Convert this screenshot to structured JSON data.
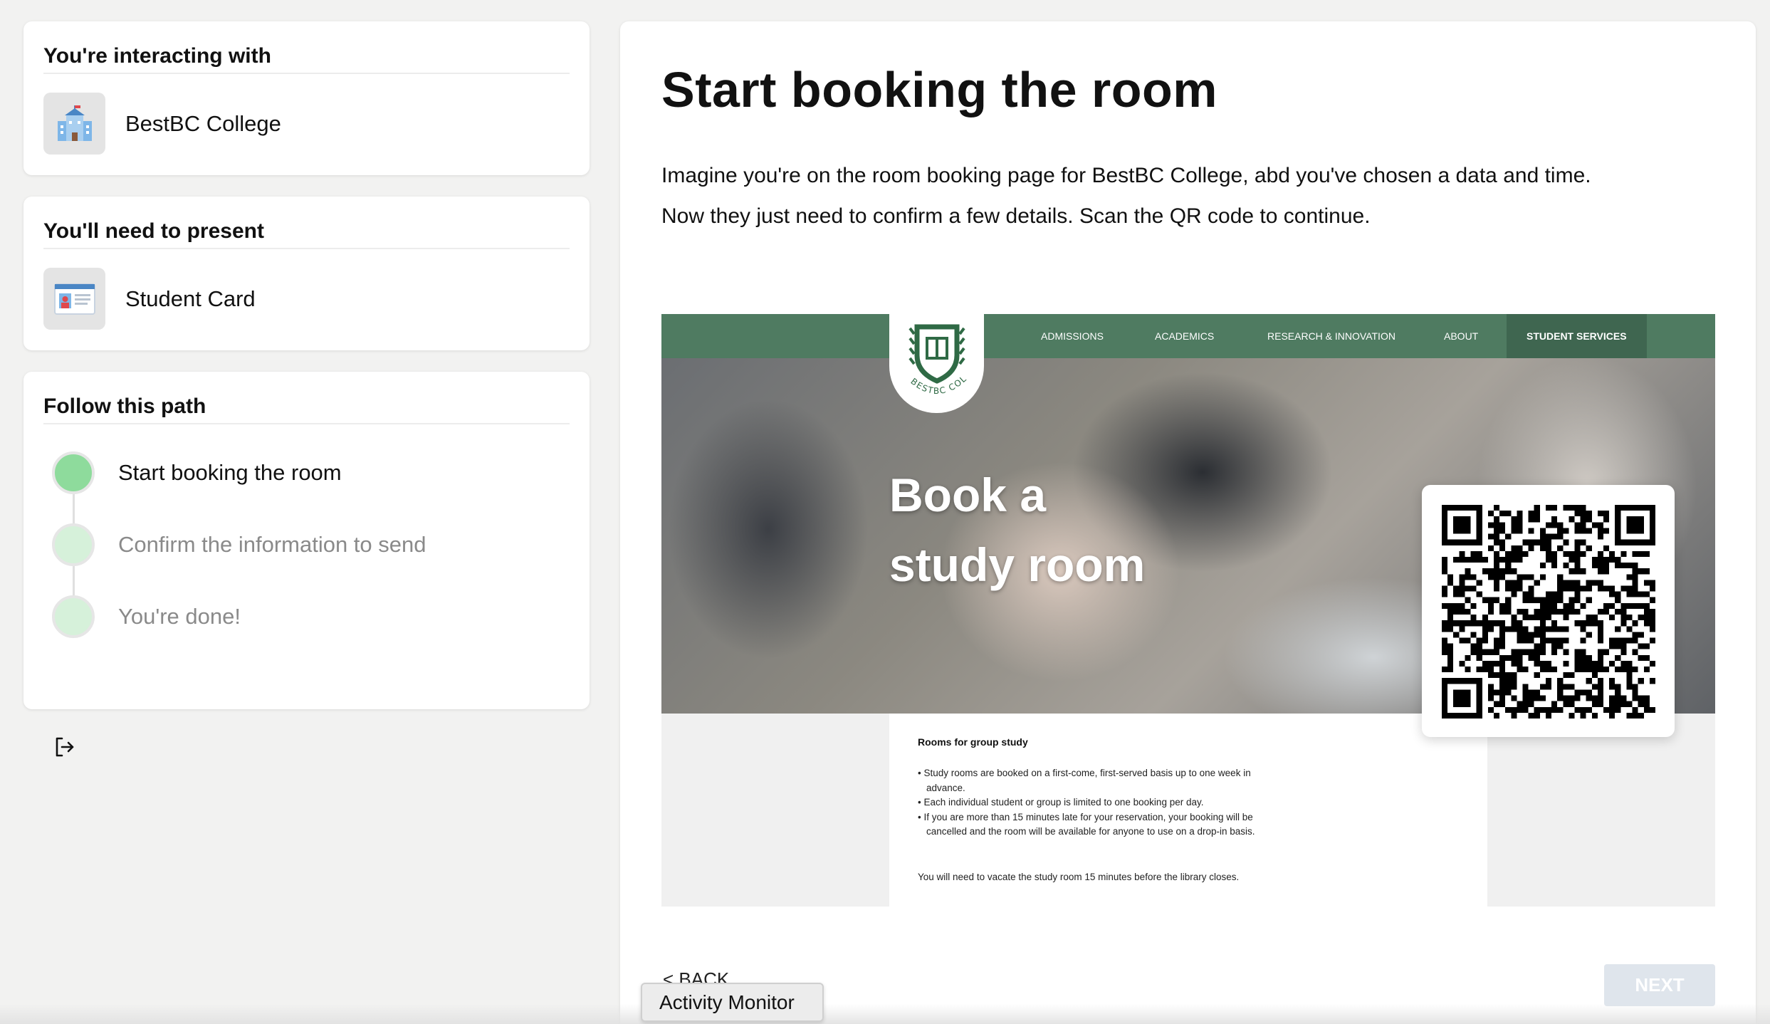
{
  "interacting": {
    "title": "You're interacting with",
    "name": "BestBC College",
    "icon": "school-building-icon"
  },
  "present": {
    "title": "You'll need to present",
    "name": "Student Card",
    "icon": "id-card-icon"
  },
  "path": {
    "title": "Follow this path",
    "steps": [
      {
        "label": "Start booking the room",
        "state": "active"
      },
      {
        "label": "Confirm the information to send",
        "state": "todo"
      },
      {
        "label": "You're done!",
        "state": "todo"
      }
    ]
  },
  "main": {
    "title": "Start booking the room",
    "description_line1": "Imagine you're on the room booking page for BestBC College, abd you've chosen a data and time.",
    "description_line2": "Now they just need to confirm a few details. Scan the QR code to continue."
  },
  "preview": {
    "nav": [
      "ADMISSIONS",
      "ACADEMICS",
      "RESEARCH & INNOVATION",
      "ABOUT",
      "STUDENT SERVICES"
    ],
    "nav_active": "STUDENT SERVICES",
    "logo_text": "BESTBC COLLEGE",
    "hero_line1": "Book a",
    "hero_line2": "study room",
    "content_heading": "Rooms for group study",
    "rules": [
      "Study rooms are booked on a first-come, first-served basis up to one week in advance.",
      "Each individual student or group is limited to one booking per day.",
      "If you are more than 15 minutes late for your reservation, your booking will be cancelled and the room will be available for anyone to use on a drop-in basis."
    ],
    "note": "You will need to vacate the study room 15 minutes before the library closes."
  },
  "footer": {
    "back_label": "< BACK",
    "next_label": "NEXT"
  },
  "tooltip": "Activity Monitor",
  "colors": {
    "brand_green": "#4f7b61",
    "step_active": "#8edb9c",
    "step_todo": "#d6f1da"
  }
}
